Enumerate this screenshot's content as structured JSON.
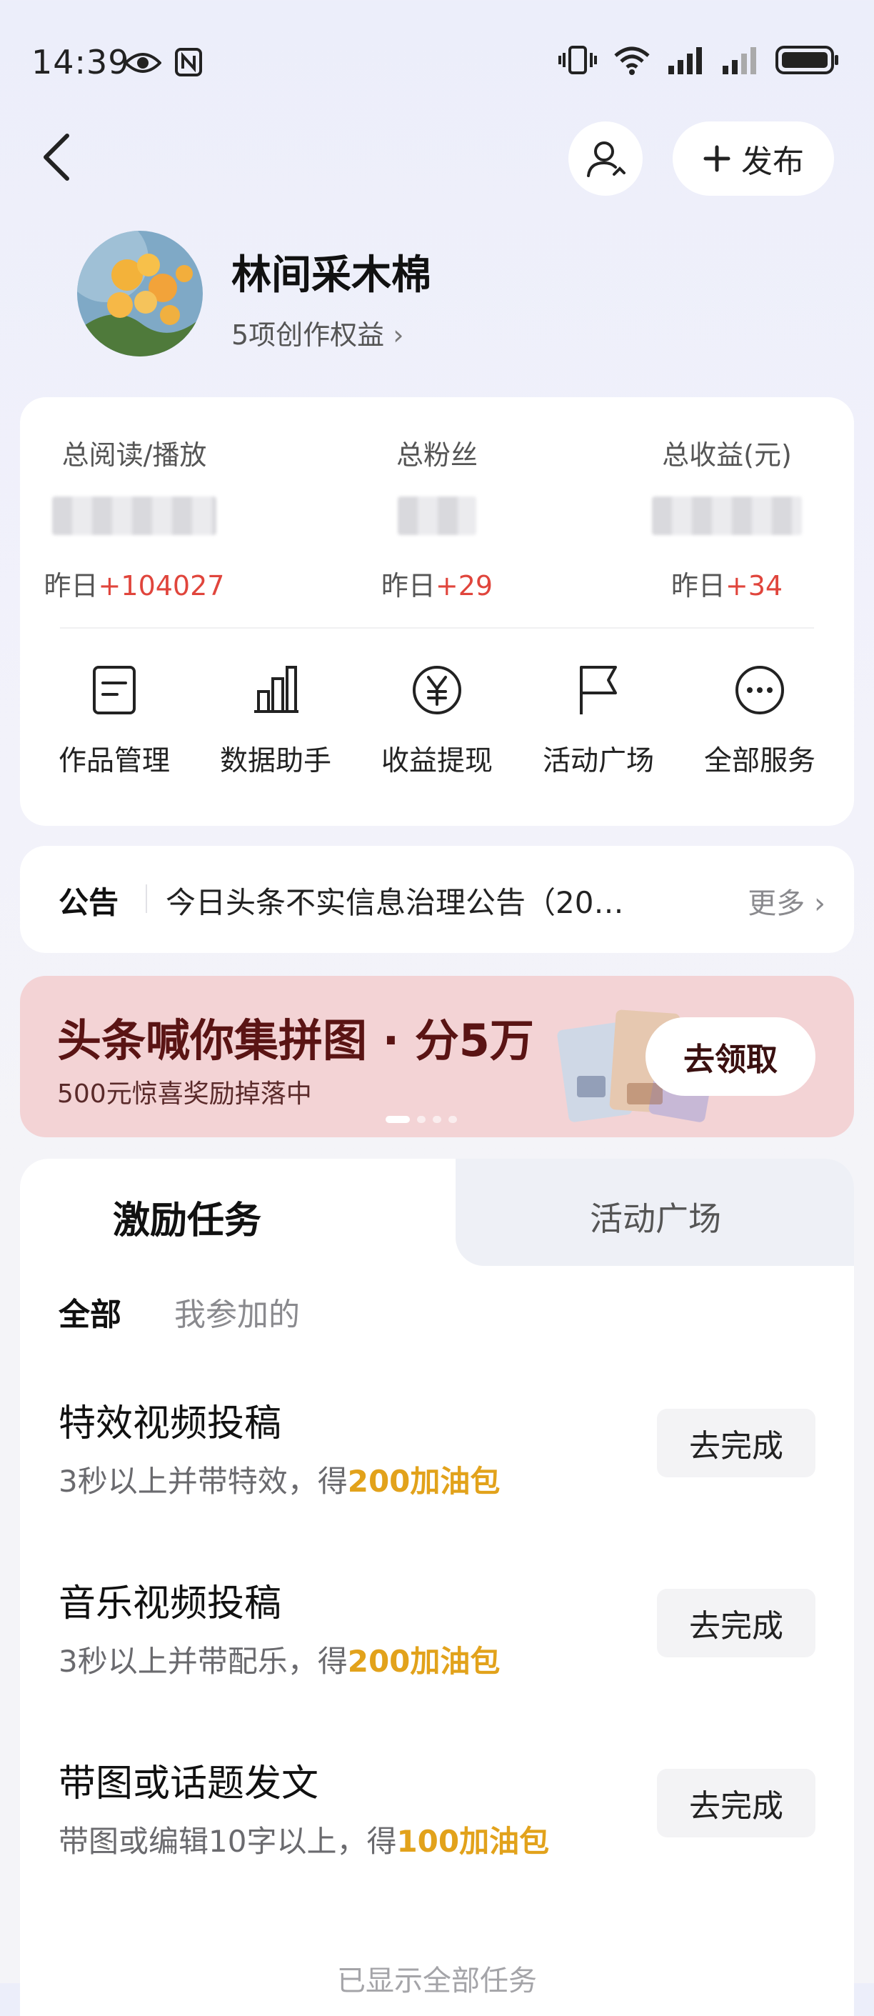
{
  "status_bar": {
    "time": "14:39",
    "icons": [
      "eye-icon",
      "nfc-icon",
      "vibrate-icon",
      "wifi-icon",
      "signal-icon",
      "signal-icon",
      "battery-icon"
    ]
  },
  "header": {
    "profile_icon": "user-icon",
    "publish_label": "发布",
    "publish_icon": "plus-icon"
  },
  "profile": {
    "name": "林间采木棉",
    "benefits": "5项创作权益"
  },
  "stats": [
    {
      "label": "总阅读/播放",
      "yesterday_prefix": "昨日",
      "yesterday_value": "+104027"
    },
    {
      "label": "总粉丝",
      "yesterday_prefix": "昨日",
      "yesterday_value": "+29"
    },
    {
      "label": "总收益(元)",
      "yesterday_prefix": "昨日",
      "yesterday_value": "+34"
    }
  ],
  "services": [
    {
      "label": "作品管理",
      "icon": "document-icon"
    },
    {
      "label": "数据助手",
      "icon": "bar-chart-icon"
    },
    {
      "label": "收益提现",
      "icon": "yen-icon"
    },
    {
      "label": "活动广场",
      "icon": "flag-icon"
    },
    {
      "label": "全部服务",
      "icon": "more-icon"
    }
  ],
  "notice": {
    "title": "公告",
    "text": "今日头条不实信息治理公告（20…",
    "more": "更多"
  },
  "banner": {
    "title": "头条喊你集拼图 · 分5万",
    "subtitle": "500元惊喜奖励掉落中",
    "button": "去领取",
    "accent": "#f3d3d5"
  },
  "tabs": {
    "active": "激励任务",
    "inactive": "活动广场"
  },
  "filters": {
    "all": "全部",
    "mine": "我参加的"
  },
  "tasks": [
    {
      "title": "特效视频投稿",
      "desc": "3秒以上并带特效，得",
      "reward": "200加油包",
      "button": "去完成"
    },
    {
      "title": "音乐视频投稿",
      "desc": "3秒以上并带配乐，得",
      "reward": "200加油包",
      "button": "去完成"
    },
    {
      "title": "带图或话题发文",
      "desc": "带图或编辑10字以上，得",
      "reward": "100加油包",
      "button": "去完成"
    }
  ],
  "footer_note": "已显示全部任务",
  "colors": {
    "increase": "#e0453c",
    "reward": "#e2a21b"
  }
}
